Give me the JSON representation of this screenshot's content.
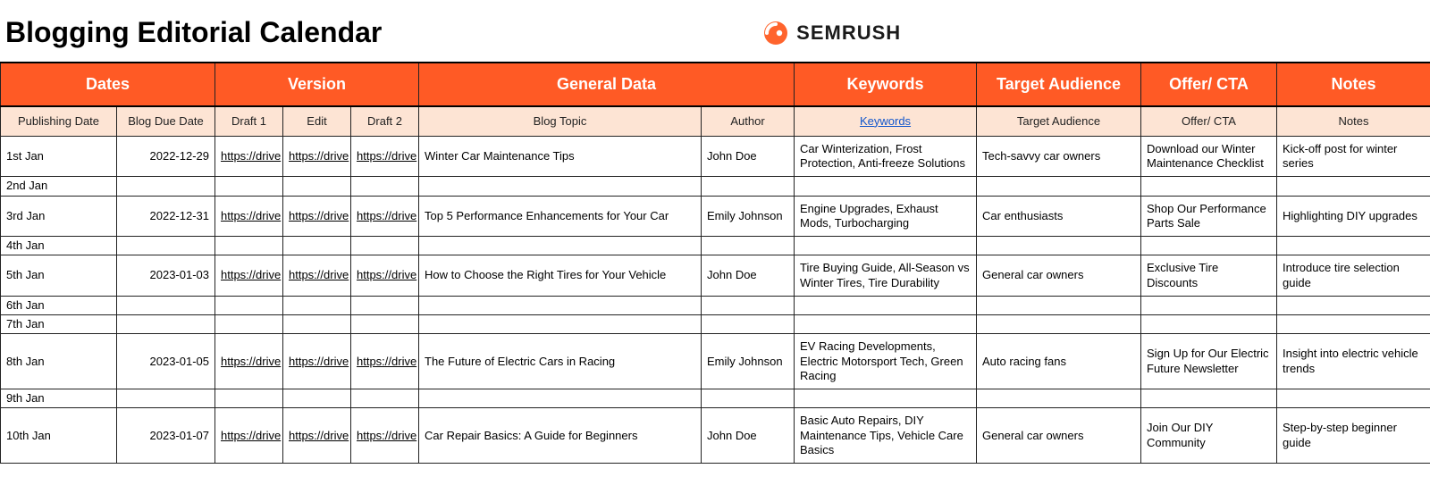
{
  "header": {
    "title": "Blogging Editorial Calendar",
    "brand": "SEMRUSH"
  },
  "groupHeaders": {
    "dates": "Dates",
    "version": "Version",
    "general": "General Data",
    "keywords": "Keywords",
    "audience": "Target Audience",
    "cta": "Offer/ CTA",
    "notes": "Notes"
  },
  "subHeaders": {
    "pubdate": "Publishing Date",
    "duedate": "Blog Due Date",
    "draft1": "Draft 1",
    "edit": "Edit",
    "draft2": "Draft 2",
    "topic": "Blog Topic",
    "author": "Author",
    "keywords": "Keywords",
    "audience": "Target Audience",
    "cta": "Offer/ CTA",
    "notes": "Notes"
  },
  "rows": [
    {
      "pubdate": "1st Jan",
      "duedate": "2022-12-29",
      "draft1": "https://drive",
      "edit": "https://drive",
      "draft2": "https://drive",
      "topic": "Winter Car Maintenance Tips",
      "author": "John Doe",
      "keywords": "Car Winterization, Frost Protection, Anti-freeze Solutions",
      "audience": "Tech-savvy car owners",
      "cta": "Download our Winter Maintenance Checklist",
      "notes": "Kick-off post for winter series"
    },
    {
      "pubdate": "2nd Jan"
    },
    {
      "pubdate": "3rd Jan",
      "duedate": "2022-12-31",
      "draft1": "https://drive",
      "edit": "https://drive",
      "draft2": "https://drive",
      "topic": "Top 5 Performance Enhancements for Your Car",
      "author": "Emily Johnson",
      "keywords": "Engine Upgrades, Exhaust Mods, Turbocharging",
      "audience": "Car enthusiasts",
      "cta": "Shop Our Performance Parts Sale",
      "notes": "Highlighting DIY upgrades"
    },
    {
      "pubdate": "4th Jan"
    },
    {
      "pubdate": "5th Jan",
      "duedate": "2023-01-03",
      "draft1": "https://drive",
      "edit": "https://drive",
      "draft2": "https://drive",
      "topic": "How to Choose the Right Tires for Your Vehicle",
      "author": "John Doe",
      "keywords": "Tire Buying Guide, All-Season vs Winter Tires, Tire Durability",
      "audience": "General car owners",
      "cta": "Exclusive Tire Discounts",
      "notes": "Introduce tire selection guide"
    },
    {
      "pubdate": "6th Jan"
    },
    {
      "pubdate": "7th Jan"
    },
    {
      "pubdate": "8th Jan",
      "duedate": "2023-01-05",
      "draft1": "https://drive",
      "edit": "https://drive",
      "draft2": "https://drive",
      "topic": "The Future of Electric Cars in Racing",
      "author": "Emily Johnson",
      "keywords": "EV Racing Developments, Electric Motorsport Tech, Green Racing",
      "audience": "Auto racing fans",
      "cta": "Sign Up for Our Electric Future Newsletter",
      "notes": "Insight into electric vehicle trends"
    },
    {
      "pubdate": "9th Jan"
    },
    {
      "pubdate": "10th Jan",
      "duedate": "2023-01-07",
      "draft1": "https://drive",
      "edit": "https://drive",
      "draft2": "https://drive",
      "topic": "Car Repair Basics: A Guide for Beginners",
      "author": "John Doe",
      "keywords": "Basic Auto Repairs, DIY Maintenance Tips, Vehicle Care Basics",
      "audience": "General car owners",
      "cta": "Join Our DIY Community",
      "notes": "Step-by-step beginner guide"
    }
  ]
}
